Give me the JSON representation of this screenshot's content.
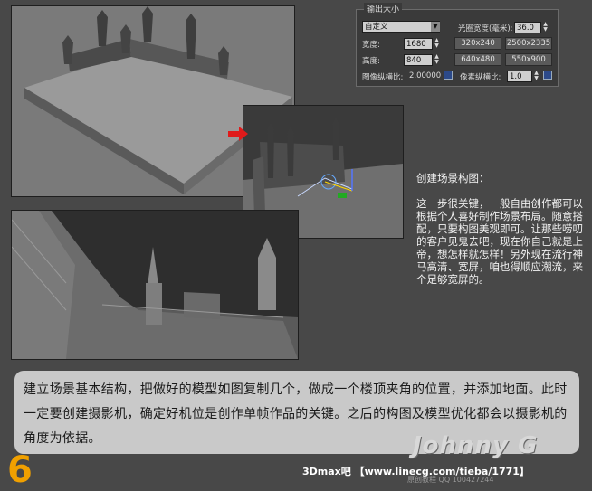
{
  "output_panel": {
    "title": "输出大小",
    "preset_value": "自定义",
    "aperture_label": "光圈宽度(毫米):",
    "aperture_value": "36.0",
    "width_label": "宽度:",
    "width_value": "1680",
    "height_label": "高度:",
    "height_value": "840",
    "image_aspect_label": "图像纵横比:",
    "image_aspect_value": "2.00000",
    "pixel_aspect_label": "像素纵横比:",
    "pixel_aspect_value": "1.0",
    "presets": [
      "320x240",
      "2500x2335",
      "640x480",
      "550x900"
    ]
  },
  "description": {
    "heading": "创建场景构图：",
    "body": "这一步很关键，一般自由创作都可以根据个人喜好制作场景布局。随意搭配，只要构图美观即可。让那些唠叨的客户见鬼去吧，现在你自己就是上帝，想怎样就怎样！另外现在流行神马高清、宽屏，咱也得顺应潮流，来个足够宽屏的。"
  },
  "caption": "建立场景基本结构，把做好的模型如图复制几个，做成一个楼顶夹角的位置，并添加地面。此时一定要创建摄影机，确定好机位是创作单帧作品的关键。之后的构图及模型优化都会以摄影机的角度为依据。",
  "step_number": "6",
  "watermark": "Johnny G",
  "credit": "3Dmax吧 【www.linecg.com/tieba/1771】",
  "faint_text": "原创教程 QQ 100427244",
  "colors": {
    "arrow": "#e01a1a",
    "step": "#f0a000",
    "caption_bg": "#c9c9c9",
    "background": "#484848"
  }
}
